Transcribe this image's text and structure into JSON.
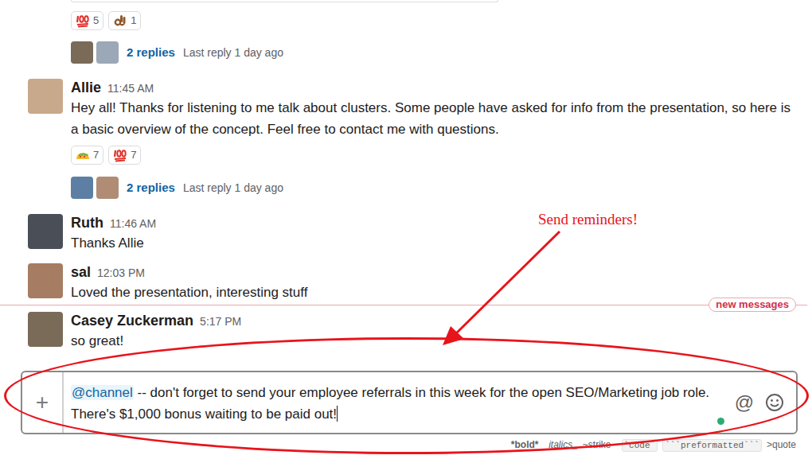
{
  "thread_top": {
    "reactions": [
      {
        "kind": "hundred",
        "count": "5"
      },
      {
        "kind": "okhand",
        "count": "1"
      }
    ],
    "replies": {
      "count": "2 replies",
      "last": "Last reply 1 day ago"
    }
  },
  "timeline": [
    {
      "kind": "message",
      "author": "Allie",
      "time": "11:45 AM",
      "text": "Hey all! Thanks for listening to me talk about clusters. Some people have asked for info from the presentation, so here is a basic overview of the concept. Feel free to contact me with questions.",
      "reactions": [
        {
          "kind": "taco",
          "count": "7"
        },
        {
          "kind": "hundred",
          "count": "7"
        }
      ],
      "replies": {
        "count": "2 replies",
        "last": "Last reply 1 day ago"
      }
    },
    {
      "kind": "message",
      "author": "Ruth",
      "time": "11:46 AM",
      "text": "Thanks Allie"
    },
    {
      "kind": "message",
      "author": "sal",
      "time": "12:03 PM",
      "text": "Loved the presentation, interesting stuff"
    },
    {
      "kind": "divider",
      "label": "new messages"
    },
    {
      "kind": "message",
      "author": "Casey Zuckerman",
      "time": "5:17 PM",
      "text": "so great!"
    }
  ],
  "composer": {
    "add": "+",
    "mention": "@channel",
    "text": " -- don't forget to send your employee referrals in this week for the open SEO/Marketing job role. There's $1,000 bonus waiting to be paid out!",
    "focused": true,
    "at_icon": "@"
  },
  "format_hints": [
    {
      "kind": "bold",
      "text": "*bold*"
    },
    {
      "kind": "italic",
      "text": "_italics_"
    },
    {
      "kind": "plain",
      "text": "~strike~"
    },
    {
      "kind": "code",
      "text": "`code`"
    },
    {
      "kind": "code",
      "text": "```preformatted```"
    },
    {
      "kind": "plain",
      "text": ">quote"
    }
  ],
  "annotation": {
    "label": "Send reminders!"
  }
}
